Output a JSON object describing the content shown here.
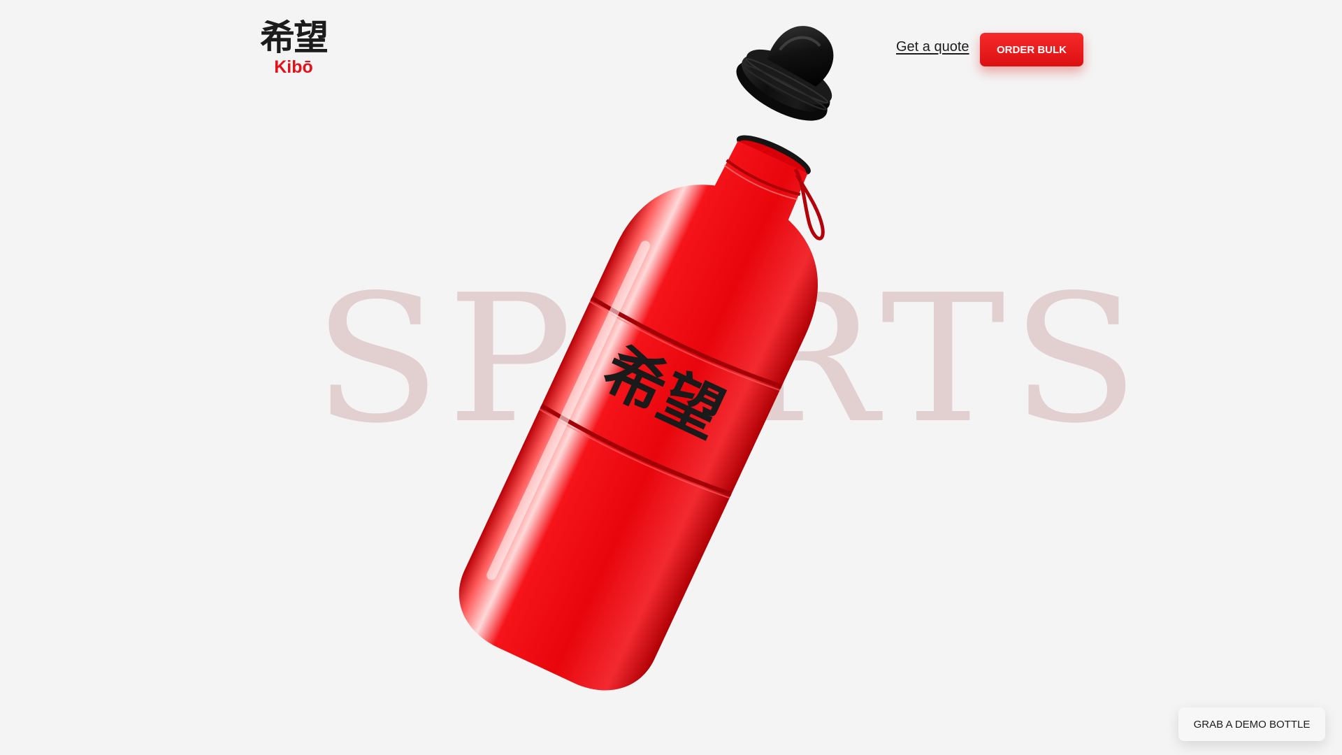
{
  "logo": {
    "kanji": "希望",
    "word": "Kibō"
  },
  "nav": {
    "quote_link": "Get a quote",
    "order_button": "ORDER BULK"
  },
  "hero": {
    "background_word": "SPORTS",
    "bottle_label": "希望",
    "product_color": "#e8060c"
  },
  "demo": {
    "button_label": "GRAB A DEMO BOTTLE"
  },
  "colors": {
    "accent": "#e3111a",
    "background": "#f4f4f4",
    "text": "#1c1c1c"
  }
}
